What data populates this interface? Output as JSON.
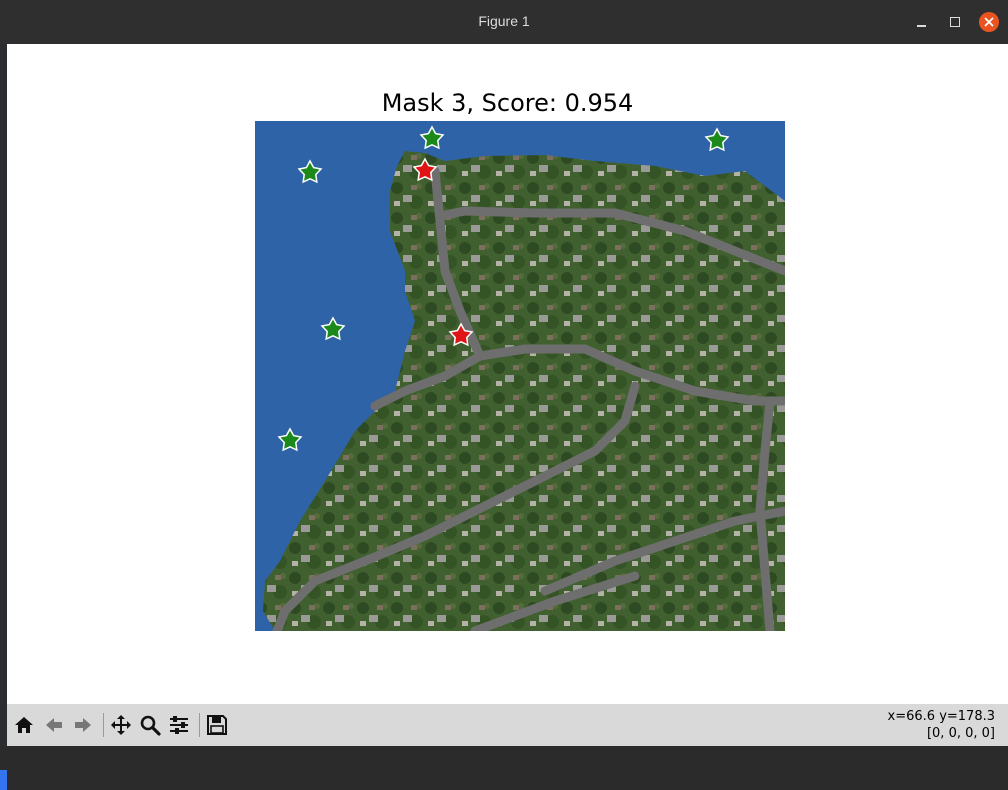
{
  "window": {
    "title": "Figure 1"
  },
  "figure": {
    "title": "Mask 3, Score: 0.954"
  },
  "map": {
    "water_color": "#2f63a8",
    "land_color": "#3f5a30",
    "road_color": "#6e6e6e",
    "positive_star_color": "#1b8a1b",
    "negative_star_color": "#e01414"
  },
  "toolbar": {
    "buttons": [
      "home-icon",
      "back-icon",
      "forward-icon",
      "pan-icon",
      "zoom-icon",
      "configure-subplots-icon",
      "save-icon"
    ]
  },
  "status": {
    "coords": "x=66.6 y=178.3",
    "pixel_value": "[0, 0, 0, 0]"
  }
}
